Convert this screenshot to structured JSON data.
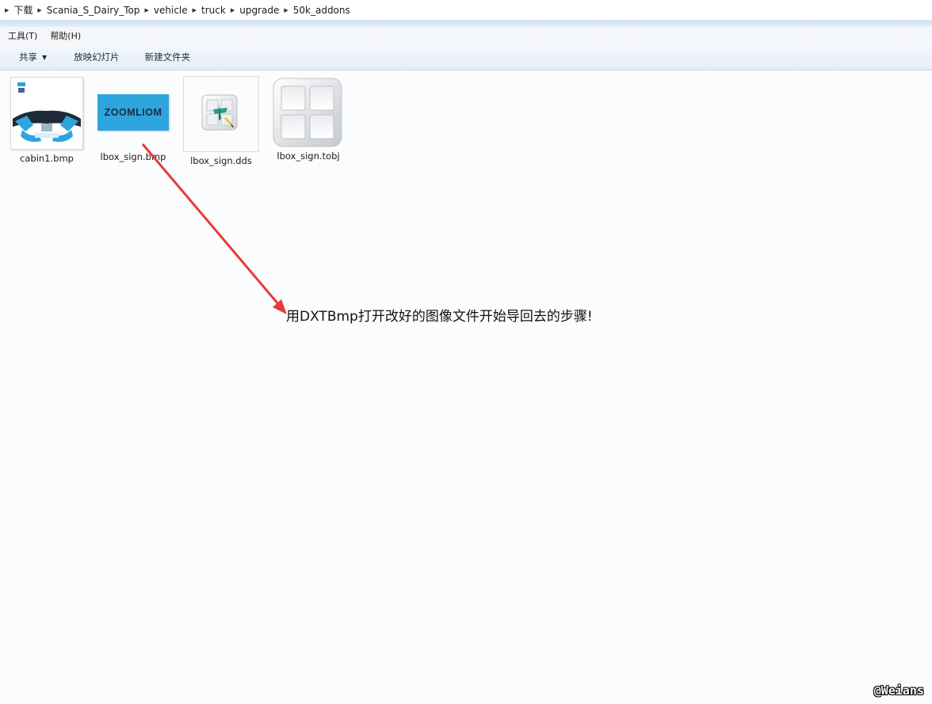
{
  "breadcrumb": [
    "下载",
    "Scania_S_Dairy_Top",
    "vehicle",
    "truck",
    "upgrade",
    "50k_addons"
  ],
  "menu": {
    "tools": "工具(T)",
    "help": "帮助(H)"
  },
  "toolbar": {
    "share": "共享",
    "slideshow": "放映幻灯片",
    "new_folder": "新建文件夹"
  },
  "files": [
    {
      "name": "cabin1.bmp",
      "icon": "cabin-bmp-thumbnail"
    },
    {
      "name": "lbox_sign.bmp",
      "icon": "sign-bmp-thumbnail",
      "thumb_text": "ZOOMLIOM"
    },
    {
      "name": "lbox_sign.dds",
      "icon": "dds-file-icon"
    },
    {
      "name": "lbox_sign.tobj",
      "icon": "tobj-file-icon"
    }
  ],
  "annotation": "用DXTBmp打开改好的图像文件开始导回去的步骤!",
  "watermark": "@Weians",
  "colors": {
    "arrow": "#e83a3a",
    "sign_bg": "#2ea4dc",
    "toolbar": "#e4edf8"
  }
}
